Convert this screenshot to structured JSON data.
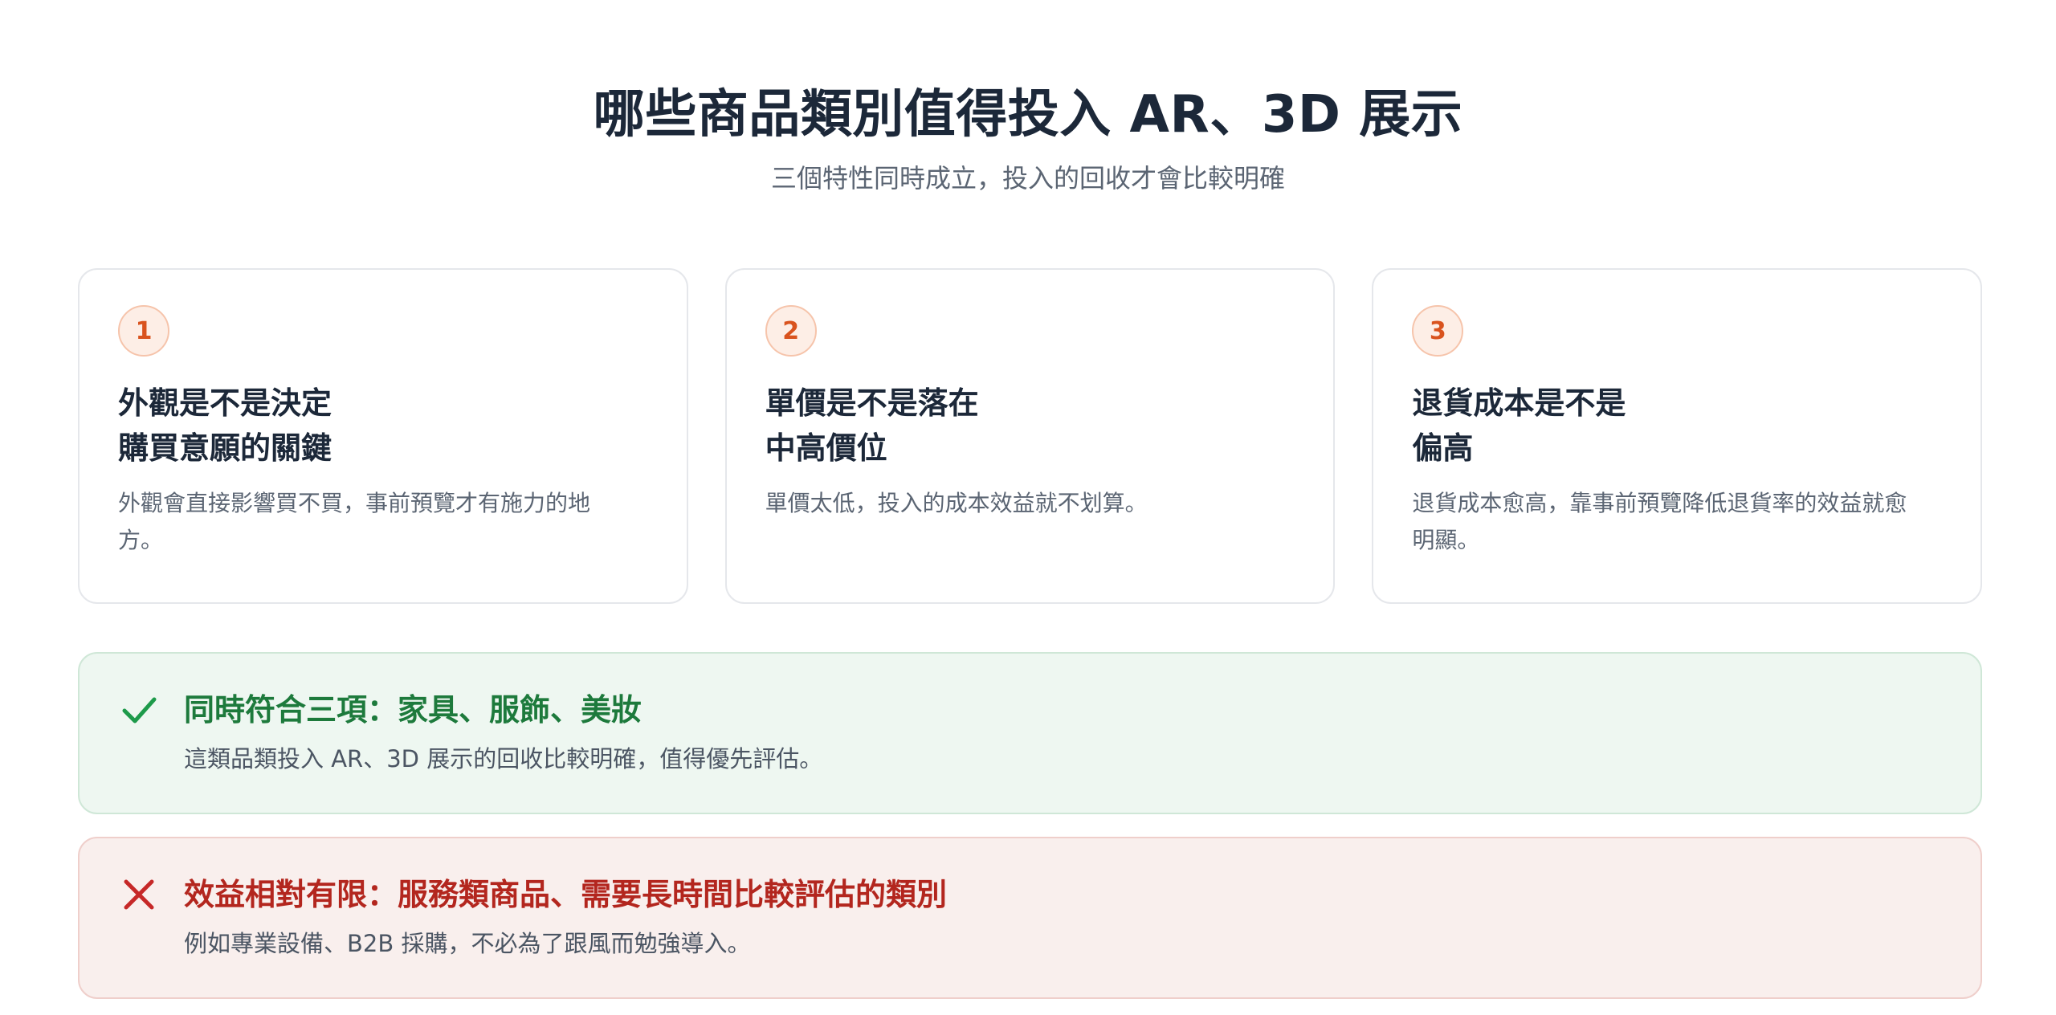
{
  "header": {
    "title": "哪些商品類別值得投入 AR、3D 展示",
    "subtitle": "三個特性同時成立，投入的回收才會比較明確"
  },
  "cards": [
    {
      "number": "1",
      "title": "外觀是不是決定\n購買意願的關鍵",
      "desc": "外觀會直接影響買不買，事前預覽才有施力的地方。"
    },
    {
      "number": "2",
      "title": "單價是不是落在\n中高價位",
      "desc": "單價太低，投入的成本效益就不划算。"
    },
    {
      "number": "3",
      "title": "退貨成本是不是\n偏高",
      "desc": "退貨成本愈高，靠事前預覽降低退貨率的效益就愈明顯。"
    }
  ],
  "positive": {
    "icon": "check-icon",
    "title": "同時符合三項：家具、服飾、美妝",
    "desc": "這類品類投入 AR、3D 展示的回收比較明確，值得優先評估。",
    "color": "#1d7a3c"
  },
  "negative": {
    "icon": "x-icon",
    "title": "效益相對有限：服務類商品、需要長時間比較評估的類別",
    "desc": "例如專業設備、B2B 採購，不必為了跟風而勉強導入。",
    "color": "#b3261e"
  },
  "colors": {
    "accent": "#d9531e",
    "badge_bg": "#fdeee6",
    "title_text": "#1c2839",
    "body_text": "#5b6573"
  }
}
